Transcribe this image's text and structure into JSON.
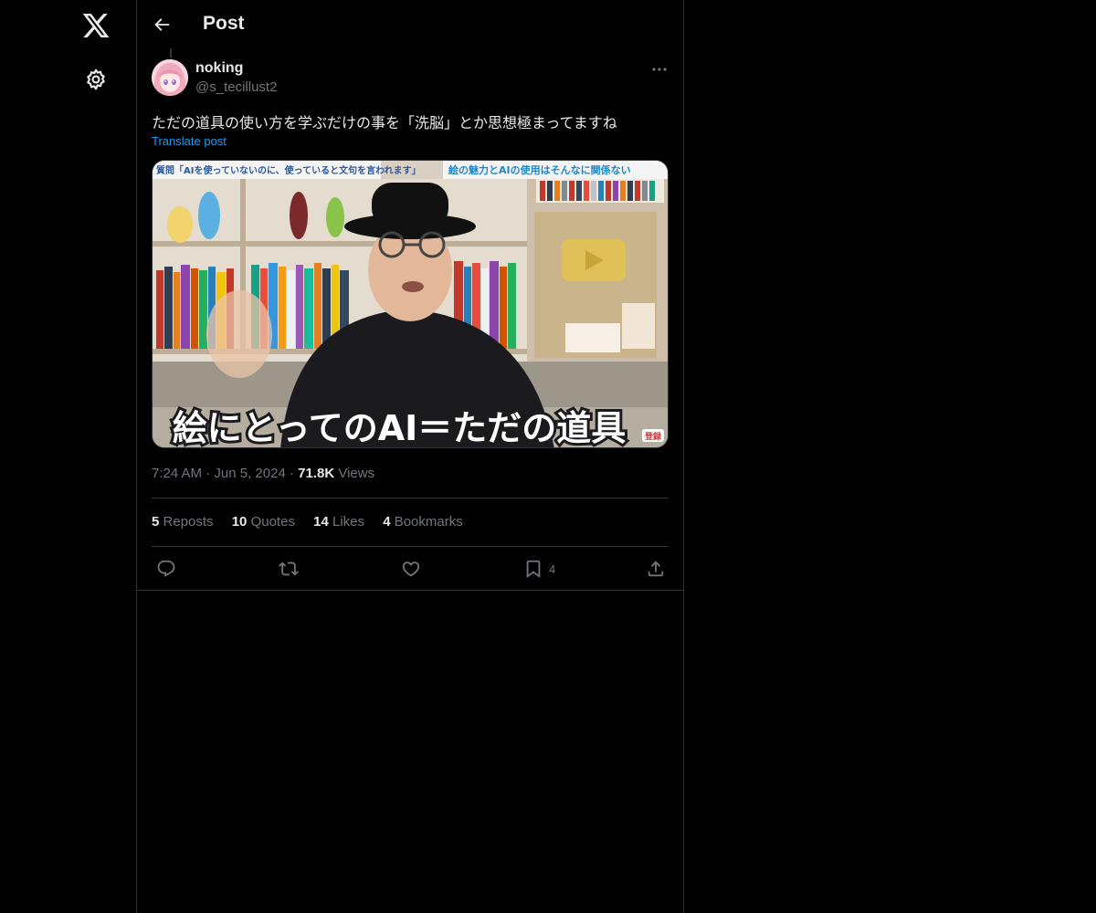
{
  "nav": {
    "logo_icon": "x-logo-icon",
    "settings_icon": "gear-icon"
  },
  "header": {
    "title": "Post",
    "back_icon": "back-arrow-icon"
  },
  "post": {
    "author": {
      "name": "noking",
      "handle": "@s_tecillust2"
    },
    "text": "ただの道具の使い方を学ぶだけの事を「洗脳」とか思想極まってますね",
    "translate_label": "Translate post",
    "media": {
      "top_left_caption": "質問「AIを使っていないのに、使っていると文句を言われます」",
      "top_right_caption": "絵の魅力とAIの使用はそんなに関係ない",
      "bottom_caption": "絵にとってのAI＝ただの道具",
      "corner_badge": "登録"
    },
    "time": "7:24 AM",
    "date": "Jun 5, 2024",
    "views_count": "71.8K",
    "views_label": "Views",
    "stats": {
      "reposts_count": "5",
      "reposts_label": "Reposts",
      "quotes_count": "10",
      "quotes_label": "Quotes",
      "likes_count": "14",
      "likes_label": "Likes",
      "bookmarks_count": "4",
      "bookmarks_label": "Bookmarks"
    },
    "actions": {
      "bookmark_count": "4"
    }
  },
  "colors": {
    "background": "#000000",
    "text_primary": "#e7e9ea",
    "text_secondary": "#71767b",
    "accent": "#1d9bf0",
    "border": "#2f3336"
  }
}
